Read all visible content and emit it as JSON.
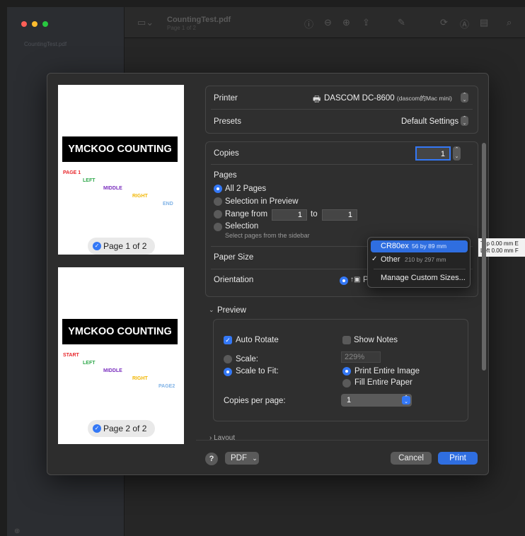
{
  "window": {
    "title": "CountingTest.pdf",
    "subtitle": "Page 1 of 2",
    "sidebar_file": "CountingTest.pdf"
  },
  "previews": [
    {
      "banner": "YMCKOO COUNTING",
      "words": [
        "PAGE 1",
        "LEFT",
        "MIDDLE",
        "RIGHT",
        "END"
      ],
      "pill": "Page 1 of 2"
    },
    {
      "banner": "YMCKOO COUNTING",
      "words": [
        "START",
        "LEFT",
        "MIDDLE",
        "RIGHT",
        "PAGE2"
      ],
      "pill": "Page 2 of 2"
    }
  ],
  "colors": {
    "accent": "#3478f6",
    "red": "#e8262b",
    "green": "#2ea84a",
    "purple": "#7b2fbf",
    "yellow": "#f2b705",
    "lightblue": "#7fb2e6"
  },
  "printer": {
    "label": "Printer",
    "value": "DASCOM DC-8600",
    "host": "(dascom的Mac mini)"
  },
  "presets": {
    "label": "Presets",
    "value": "Default Settings"
  },
  "copies": {
    "label": "Copies",
    "value": "1"
  },
  "pages": {
    "label": "Pages",
    "all": "All 2 Pages",
    "selection_preview": "Selection in Preview",
    "range_from": "Range from",
    "range_start": "1",
    "range_to": "to",
    "range_end": "1",
    "selection": "Selection",
    "selection_hint": "Select pages from the sidebar"
  },
  "paper_size": {
    "label": "Paper Size"
  },
  "orientation": {
    "label": "Orientation",
    "partial": "P"
  },
  "paper_menu": {
    "items": [
      {
        "name": "CR80ex",
        "size": "56 by 89 mm"
      },
      {
        "name": "Other",
        "size": "210 by 297 mm"
      }
    ],
    "manage": "Manage Custom Sizes..."
  },
  "tooltip": {
    "line1": "Top 0.00 mm  E",
    "line2": "Left 0.00 mm  F"
  },
  "preview": {
    "section": "Preview",
    "auto_rotate": "Auto Rotate",
    "show_notes": "Show Notes",
    "scale": "Scale:",
    "scale_value": "229%",
    "scale_to_fit": "Scale to Fit:",
    "print_entire_image": "Print Entire Image",
    "fill_entire_paper": "Fill Entire Paper",
    "copies_per_page": "Copies per page:",
    "copies_per_page_value": "1"
  },
  "layout": {
    "section": "Layout"
  },
  "footer": {
    "help": "?",
    "pdf": "PDF",
    "cancel": "Cancel",
    "print": "Print"
  }
}
